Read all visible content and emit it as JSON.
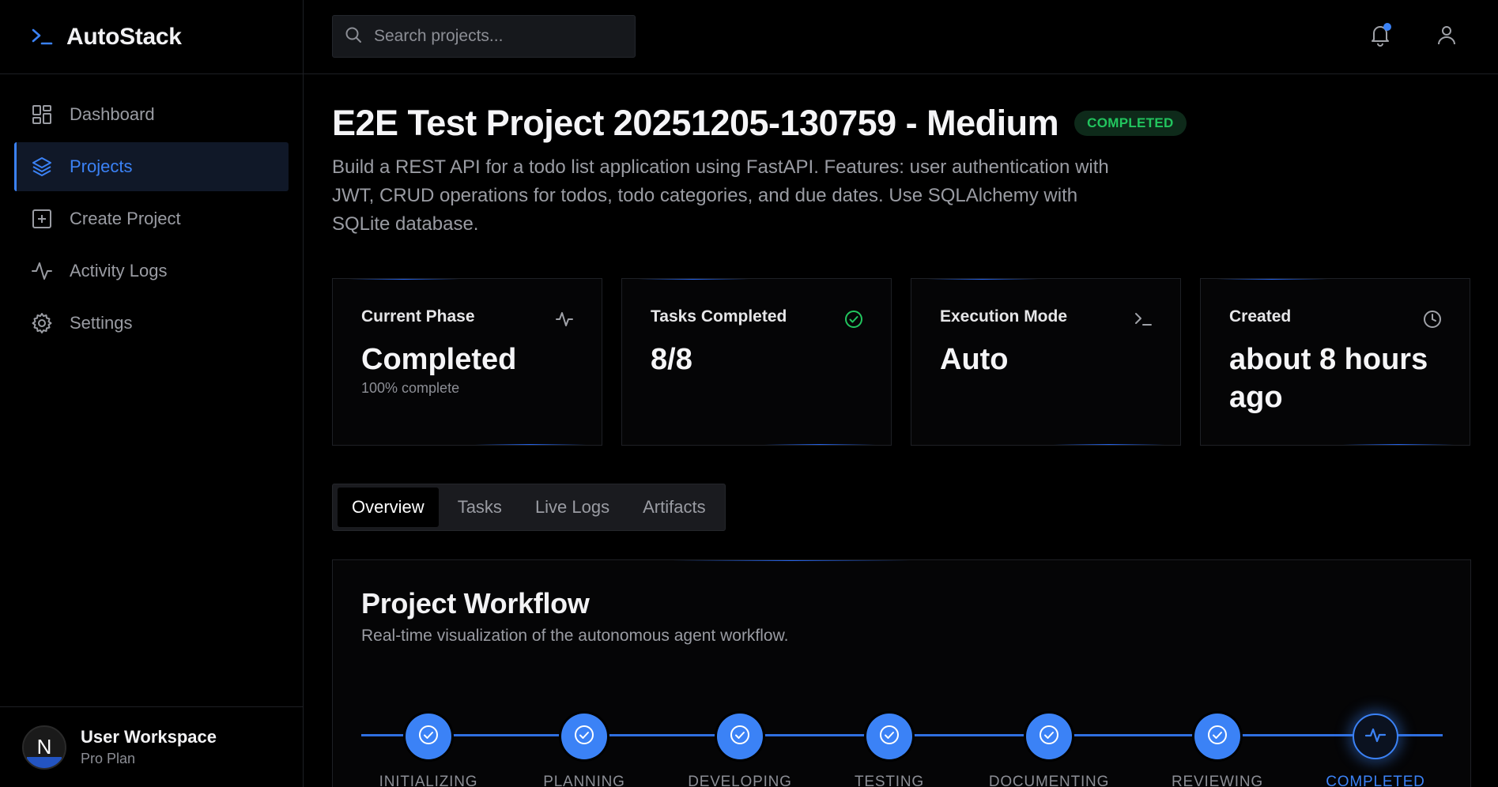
{
  "app": {
    "name": "AutoStack"
  },
  "sidebar": {
    "items": [
      {
        "label": "Dashboard",
        "icon": "dashboard-icon",
        "active": false
      },
      {
        "label": "Projects",
        "icon": "layers-icon",
        "active": true
      },
      {
        "label": "Create Project",
        "icon": "plus-square-icon",
        "active": false
      },
      {
        "label": "Activity Logs",
        "icon": "activity-icon",
        "active": false
      },
      {
        "label": "Settings",
        "icon": "gear-icon",
        "active": false
      }
    ],
    "workspace": {
      "avatar_letter": "N",
      "name": "User Workspace",
      "plan": "Pro Plan"
    }
  },
  "header": {
    "search_placeholder": "Search projects...",
    "has_notification": true
  },
  "project": {
    "title": "E2E Test Project 20251205-130759 - Medium",
    "status": "COMPLETED",
    "description": "Build a REST API for a todo list application using FastAPI. Features: user authentication with JWT, CRUD operations for todos, todo categories, and due dates. Use SQLAlchemy with SQLite database."
  },
  "stats": [
    {
      "label": "Current Phase",
      "value": "Completed",
      "sub": "100% complete",
      "icon": "activity-icon"
    },
    {
      "label": "Tasks Completed",
      "value": "8/8",
      "sub": "",
      "icon": "check-circle-icon"
    },
    {
      "label": "Execution Mode",
      "value": "Auto",
      "sub": "",
      "icon": "terminal-icon"
    },
    {
      "label": "Created",
      "value": "about 8 hours ago",
      "sub": "",
      "icon": "clock-icon"
    }
  ],
  "tabs": [
    "Overview",
    "Tasks",
    "Live Logs",
    "Artifacts"
  ],
  "active_tab": "Overview",
  "workflow": {
    "title": "Project Workflow",
    "subtitle": "Real-time visualization of the autonomous agent workflow.",
    "steps": [
      {
        "label": "INITIALIZING",
        "state": "done"
      },
      {
        "label": "PLANNING",
        "state": "done"
      },
      {
        "label": "DEVELOPING",
        "state": "done"
      },
      {
        "label": "TESTING",
        "state": "done"
      },
      {
        "label": "DOCUMENTING",
        "state": "done"
      },
      {
        "label": "REVIEWING",
        "state": "done"
      },
      {
        "label": "COMPLETED",
        "state": "current"
      }
    ]
  },
  "colors": {
    "accent": "#3b82f6",
    "success": "#22c55e",
    "background": "#000000"
  }
}
